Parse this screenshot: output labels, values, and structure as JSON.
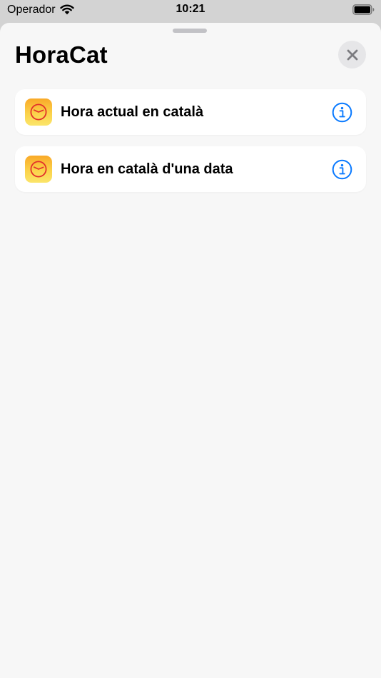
{
  "status_bar": {
    "carrier": "Operador",
    "time": "10:21"
  },
  "sheet": {
    "title": "HoraCat",
    "close_icon": "close-icon"
  },
  "shortcuts": [
    {
      "label": "Hora actual en català",
      "icon": "clock-app-icon",
      "action_icon": "info-icon"
    },
    {
      "label": "Hora en català d'una data",
      "icon": "clock-app-icon",
      "action_icon": "info-icon"
    }
  ],
  "colors": {
    "accent": "#0a7aff",
    "app_icon_top": "#f9a928",
    "app_icon_bottom": "#fbe56a",
    "clock_stroke": "#e2312b",
    "sheet_background": "#f7f7f7",
    "row_background": "#ffffff"
  }
}
